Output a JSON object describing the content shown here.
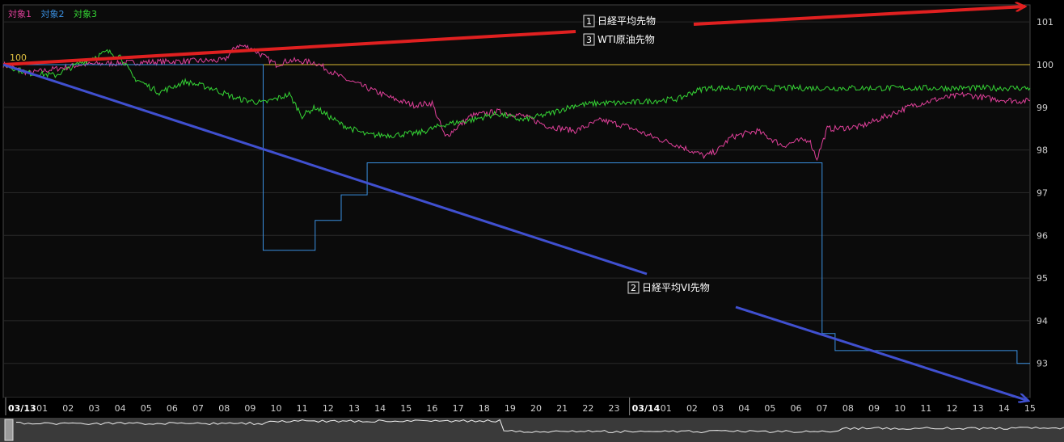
{
  "legend": {
    "s1": "対象1",
    "s2": "対象2",
    "s3": "対象3"
  },
  "colors": {
    "background": "#0b0b0b",
    "grid": "#2a2a2a",
    "series1": "#e0409a",
    "series2": "#3a8fe0",
    "series3": "#35d635",
    "baseline": "#d8b830",
    "red_arrow": "#e02020",
    "blue_arrow": "#4050d0"
  },
  "chart_data": {
    "type": "line",
    "baseline_label": "100",
    "ylim": [
      92.2,
      101.4
    ],
    "yticks": [
      "101",
      "100",
      "99",
      "98",
      "97",
      "96",
      "95",
      "94",
      "93"
    ],
    "xtick_labels": [
      "03/13",
      "01",
      "02",
      "03",
      "04",
      "05",
      "06",
      "07",
      "08",
      "09",
      "10",
      "11",
      "12",
      "13",
      "14",
      "15",
      "16",
      "17",
      "18",
      "19",
      "20",
      "21",
      "22",
      "23",
      "03/14",
      "01",
      "02",
      "03",
      "04",
      "05",
      "06",
      "07",
      "08",
      "09",
      "10",
      "11",
      "12",
      "13",
      "14",
      "15"
    ],
    "series": [
      {
        "name": "対象1",
        "points": [
          [
            0,
            100.0
          ],
          [
            1,
            99.8
          ],
          [
            3,
            100.0
          ],
          [
            5,
            100.05
          ],
          [
            7,
            100.08
          ],
          [
            8.5,
            100.1
          ],
          [
            9,
            100.45
          ],
          [
            9.5,
            100.4
          ],
          [
            10,
            100.2
          ],
          [
            10.5,
            100.0
          ],
          [
            11,
            100.1
          ],
          [
            12,
            100.05
          ],
          [
            13,
            99.7
          ],
          [
            14,
            99.45
          ],
          [
            15,
            99.2
          ],
          [
            15.8,
            99.05
          ],
          [
            16.5,
            99.1
          ],
          [
            17,
            98.3
          ],
          [
            17.5,
            98.55
          ],
          [
            18,
            98.8
          ],
          [
            19,
            98.9
          ],
          [
            20,
            98.8
          ],
          [
            21,
            98.55
          ],
          [
            22,
            98.45
          ],
          [
            23,
            98.7
          ],
          [
            24,
            98.55
          ],
          [
            25,
            98.3
          ],
          [
            26,
            98.1
          ],
          [
            27,
            97.85
          ],
          [
            27.5,
            98.0
          ],
          [
            28,
            98.3
          ],
          [
            29,
            98.45
          ],
          [
            30,
            98.1
          ],
          [
            30.5,
            98.2
          ],
          [
            31,
            98.25
          ],
          [
            31.3,
            97.8
          ],
          [
            31.7,
            98.5
          ],
          [
            32,
            98.5
          ],
          [
            33,
            98.55
          ],
          [
            34,
            98.8
          ],
          [
            35,
            99.05
          ],
          [
            36,
            99.2
          ],
          [
            37,
            99.3
          ],
          [
            38,
            99.2
          ],
          [
            39,
            99.15
          ],
          [
            39.5,
            99.15
          ]
        ]
      },
      {
        "name": "対象2",
        "points": [
          [
            0,
            100.0
          ],
          [
            10,
            100.0
          ],
          [
            10,
            95.65
          ],
          [
            12,
            95.65
          ],
          [
            12,
            96.35
          ],
          [
            13,
            96.35
          ],
          [
            13,
            96.95
          ],
          [
            14,
            96.95
          ],
          [
            14,
            97.7
          ],
          [
            31.5,
            97.7
          ],
          [
            31.5,
            93.7
          ],
          [
            32,
            93.7
          ],
          [
            32,
            93.3
          ],
          [
            39,
            93.3
          ],
          [
            39,
            93.0
          ],
          [
            39.5,
            93.0
          ]
        ]
      },
      {
        "name": "対象3",
        "points": [
          [
            0,
            100.0
          ],
          [
            1,
            99.8
          ],
          [
            2,
            99.75
          ],
          [
            3,
            100.05
          ],
          [
            4,
            100.3
          ],
          [
            4.5,
            100.2
          ],
          [
            5,
            99.7
          ],
          [
            6,
            99.35
          ],
          [
            7,
            99.6
          ],
          [
            8,
            99.45
          ],
          [
            9,
            99.2
          ],
          [
            10,
            99.1
          ],
          [
            11,
            99.3
          ],
          [
            11.5,
            98.8
          ],
          [
            12,
            99.0
          ],
          [
            13,
            98.6
          ],
          [
            14,
            98.35
          ],
          [
            15,
            98.35
          ],
          [
            16,
            98.4
          ],
          [
            17,
            98.6
          ],
          [
            18,
            98.7
          ],
          [
            19,
            98.85
          ],
          [
            20,
            98.7
          ],
          [
            21,
            98.85
          ],
          [
            22,
            99.05
          ],
          [
            23,
            99.1
          ],
          [
            24,
            99.1
          ],
          [
            25,
            99.15
          ],
          [
            26,
            99.2
          ],
          [
            26.5,
            99.35
          ],
          [
            27,
            99.45
          ],
          [
            39.5,
            99.45
          ]
        ]
      }
    ],
    "annotations": [
      {
        "num": "1",
        "text": "日経平均先物"
      },
      {
        "num": "3",
        "text": "WTI原油先物"
      },
      {
        "num": "2",
        "text": "日経平均VI先物"
      }
    ]
  }
}
